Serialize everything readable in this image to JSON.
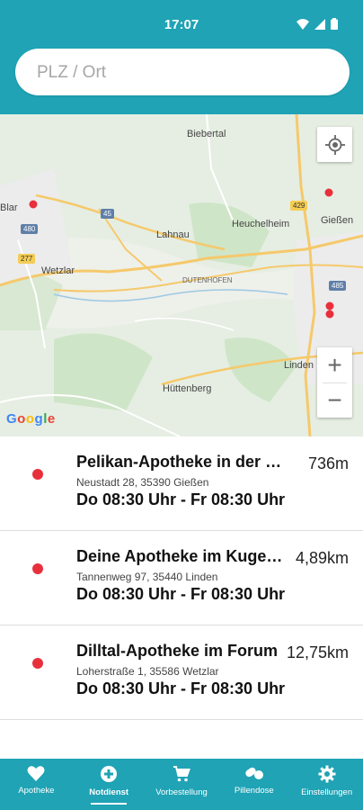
{
  "status_bar": {
    "time": "17:07"
  },
  "search": {
    "placeholder": "PLZ / Ort",
    "value": ""
  },
  "map": {
    "labels": {
      "biebertal": "Biebertal",
      "heuchelheim": "Heuchelheim",
      "giessen": "Gießen",
      "lahnau": "Lahnau",
      "wetzlar": "Wetzlar",
      "dutenhofen": "DUTENHOFEN",
      "linden": "Linden",
      "huettenberg": "Hüttenberg",
      "blar": "Blar"
    },
    "shields": {
      "a45": "45",
      "a480": "480",
      "a429": "429",
      "a277": "277",
      "a485": "485"
    },
    "attribution": "Google",
    "zoom_in": "+",
    "zoom_out": "−",
    "marker_color": "#e8303c"
  },
  "pharmacies": [
    {
      "name": "Pelikan-Apotheke in der Neustadt",
      "address": "Neustadt 28, 35390 Gießen",
      "hours": "Do 08:30 Uhr - Fr 08:30 Uhr",
      "distance": "736m"
    },
    {
      "name": "Deine Apotheke im Kugelhof",
      "address": "Tannenweg 97, 35440 Linden",
      "hours": "Do 08:30 Uhr - Fr 08:30 Uhr",
      "distance": "4,89km"
    },
    {
      "name": "Dilltal-Apotheke im Forum",
      "address": "Loherstraße 1, 35586 Wetzlar",
      "hours": "Do 08:30 Uhr - Fr 08:30 Uhr",
      "distance": "12,75km"
    }
  ],
  "bottom_nav": [
    {
      "label": "Apotheke",
      "icon": "heart-icon",
      "active": false
    },
    {
      "label": "Notdienst",
      "icon": "emergency-icon",
      "active": true
    },
    {
      "label": "Vorbestellung",
      "icon": "cart-icon",
      "active": false
    },
    {
      "label": "Pillendose",
      "icon": "pills-icon",
      "active": false
    },
    {
      "label": "Einstellungen",
      "icon": "gear-icon",
      "active": false
    }
  ],
  "colors": {
    "accent": "#1fa3b5"
  }
}
